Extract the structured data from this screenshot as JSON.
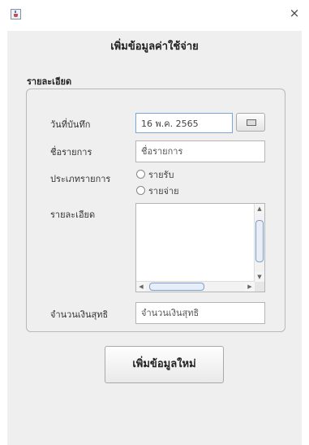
{
  "window": {
    "close_symbol": "×",
    "app_icon": "java-cup-icon"
  },
  "heading": "เพิ่มข้อมูลค่าใช้จ่าย",
  "section_label": "รายละเอียด",
  "form": {
    "date_label": "วันที่บันทึก",
    "date_value": "16 พ.ค. 2565",
    "name_label": "ชื่อรายการ",
    "name_placeholder": "ชื่อรายการ",
    "type_label": "ประเภทรายการ",
    "type_options": [
      "รายรับ",
      "รายจ่าย"
    ],
    "detail_label": "รายละเอียด",
    "net_amount_label": "จำนวนเงินสุทธิ",
    "net_amount_placeholder": "จำนวนเงินสุทธิ"
  },
  "submit_label": "เพิ่มข้อมูลใหม่",
  "colors": {
    "background": "#efefef",
    "field_border": "#b5b5b5",
    "focus_border": "#7aa7d6"
  }
}
